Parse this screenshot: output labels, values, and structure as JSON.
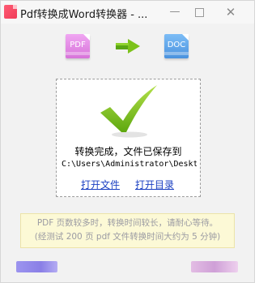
{
  "window": {
    "title": "Pdf转换成Word转换器 - ...",
    "minimize_glyph": "—",
    "close_glyph": "✕"
  },
  "conversion": {
    "source_label": "PDF",
    "target_label": "DOC",
    "arrow_icon": "right-arrow-icon",
    "source_color": "#dc7adf",
    "target_color": "#4f97e0",
    "arrow_color": "#6fbf1e"
  },
  "result": {
    "check_icon": "checkmark-icon",
    "check_color": "#7cc21b",
    "status_text": "转换完成，文件已保存到",
    "saved_path": "C:\\Users\\Administrator\\Desktop",
    "open_file_label": "打开文件",
    "open_dir_label": "打开目录",
    "link_color": "#1a3fc2"
  },
  "notice": {
    "line1": "PDF 页数较多时，转换时间较长，请耐心等待。",
    "line2": "(经测试 200 页 pdf 文件转换时间大约为 5 分钟)"
  }
}
